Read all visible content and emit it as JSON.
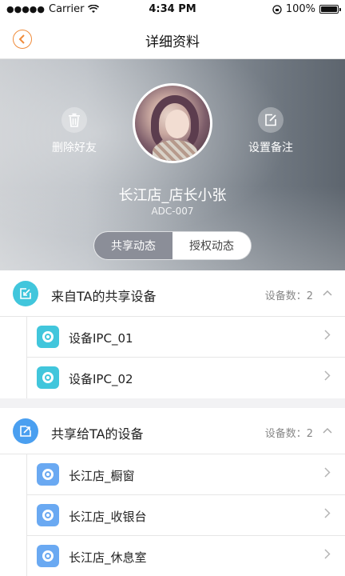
{
  "status_bar": {
    "carrier": "Carrier",
    "time": "4:34 PM",
    "battery": "100%"
  },
  "nav": {
    "title": "详细资料",
    "back_icon": "back-chevron-icon",
    "accent_color": "#f08b3a"
  },
  "profile": {
    "name": "长江店_店长小张",
    "id": "ADC-007",
    "delete_label": "删除好友",
    "remark_label": "设置备注",
    "tabs": [
      {
        "label": "共享动态",
        "active": true
      },
      {
        "label": "授权动态",
        "active": false
      }
    ]
  },
  "shared_from": {
    "title": "来自TA的共享设备",
    "count_label": "设备数：2",
    "icon_color": "#41c6dc",
    "devices": [
      {
        "label": "设备IPC_01"
      },
      {
        "label": "设备IPC_02"
      }
    ]
  },
  "shared_to": {
    "title": "共享给TA的设备",
    "count_label": "设备数：2",
    "icon_color": "#4a9ff0",
    "devices": [
      {
        "label": "长江店_橱窗"
      },
      {
        "label": "长江店_收银台"
      },
      {
        "label": "长江店_休息室"
      }
    ]
  }
}
